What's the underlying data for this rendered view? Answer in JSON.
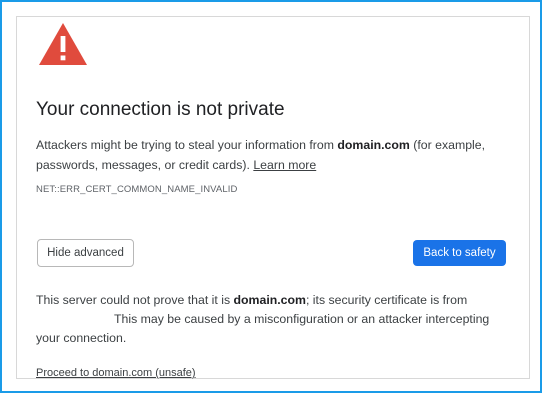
{
  "icons": {
    "warning": "warning-triangle-icon"
  },
  "colors": {
    "frame_border": "#1a9be8",
    "warning_red": "#e04b3d",
    "primary_button": "#1a73e8"
  },
  "interstitial": {
    "title": "Your connection is not private",
    "description": {
      "before_domain": "Attackers might be trying to steal your information from ",
      "domain": "domain.com",
      "after_domain": " (for example, passwords, messages, or credit cards). ",
      "learn_more": "Learn more"
    },
    "error_code": "NET::ERR_CERT_COMMON_NAME_INVALID",
    "buttons": {
      "hide_advanced": "Hide advanced",
      "back_to_safety": "Back to safety"
    },
    "advanced": {
      "before_domain": "This server could not prove that it is ",
      "domain": "domain.com",
      "after_domain": "; its security certificate is from",
      "continued": "This may be caused by a misconfiguration or an attacker intercepting your connection."
    },
    "proceed_link": "Proceed to domain.com (unsafe)"
  }
}
